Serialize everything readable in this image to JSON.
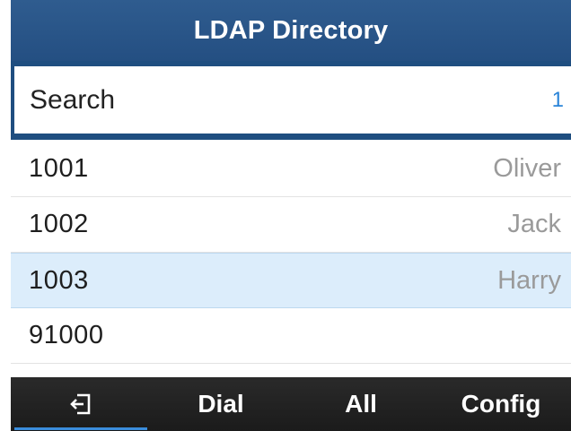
{
  "header": {
    "title": "LDAP Directory"
  },
  "search": {
    "label": "Search",
    "value": "1"
  },
  "contacts": [
    {
      "number": "1001",
      "name": "Oliver"
    },
    {
      "number": "1002",
      "name": "Jack"
    },
    {
      "number": "1003",
      "name": "Harry"
    },
    {
      "number": "91000",
      "name": ""
    }
  ],
  "selected_index": 2,
  "softkeys": {
    "back_icon": "exit-icon",
    "dial": "Dial",
    "all": "All",
    "config": "Config"
  },
  "colors": {
    "header": "#244f82",
    "selected_row": "#dcedfb",
    "accent": "#3a8ddc",
    "softkey_bar": "#1f1f1f"
  }
}
